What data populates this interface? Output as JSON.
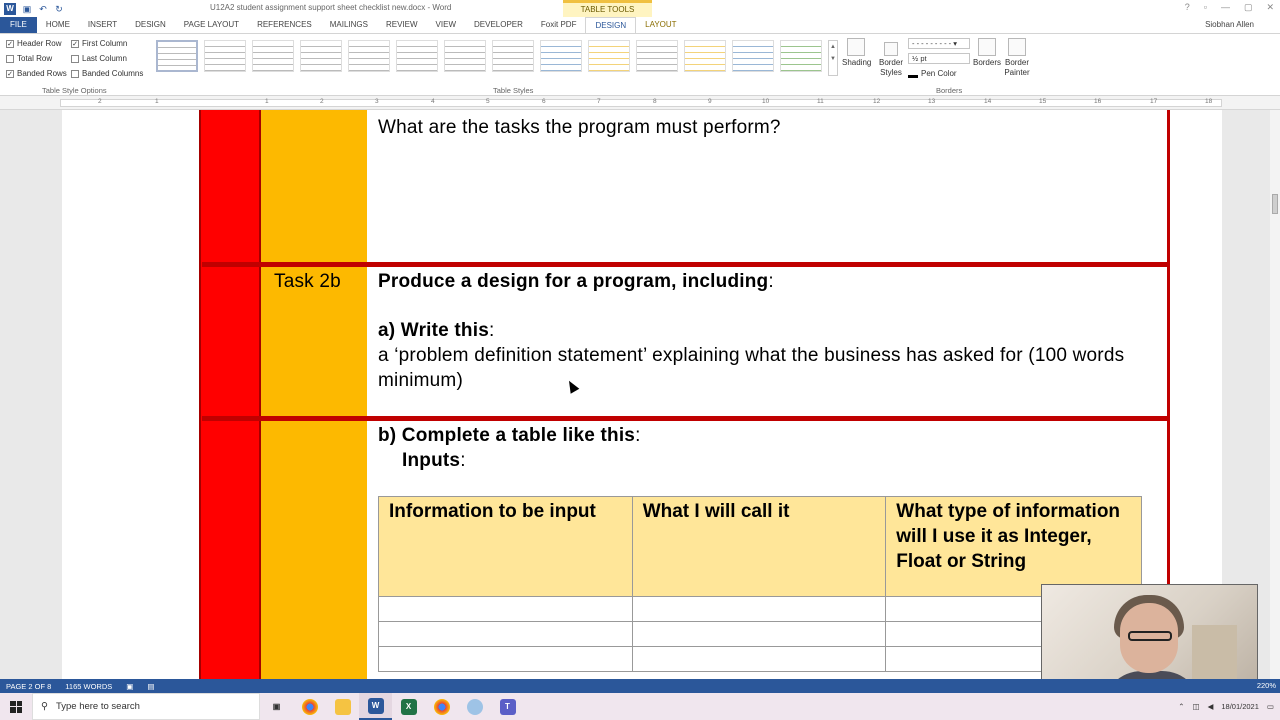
{
  "window": {
    "title": "U12A2 student assignment support sheet checklist new.docx - Word",
    "context_label": "TABLE TOOLS",
    "user": "Siobhan Allen",
    "controls": [
      "?",
      "▫",
      "—",
      "▢",
      "✕"
    ]
  },
  "ribbon_tabs": [
    {
      "label": "FILE"
    },
    {
      "label": "HOME"
    },
    {
      "label": "INSERT"
    },
    {
      "label": "DESIGN"
    },
    {
      "label": "PAGE LAYOUT"
    },
    {
      "label": "REFERENCES"
    },
    {
      "label": "MAILINGS"
    },
    {
      "label": "REVIEW"
    },
    {
      "label": "VIEW"
    },
    {
      "label": "DEVELOPER"
    },
    {
      "label": "Foxit PDF"
    },
    {
      "label": "DESIGN"
    },
    {
      "label": "LAYOUT"
    }
  ],
  "table_style_options": {
    "header_row": "Header Row",
    "total_row": "Total Row",
    "banded_rows": "Banded Rows",
    "first_column": "First Column",
    "last_column": "Last Column",
    "banded_columns": "Banded Columns",
    "group_label": "Table Style Options"
  },
  "table_styles_label": "Table Styles",
  "borders_group": {
    "shading": "Shading",
    "border_styles": "Border Styles",
    "pen_weight": "½ pt",
    "pen_color": "Pen Color",
    "borders": "Borders",
    "border_painter": "Border Painter",
    "group_label": "Borders"
  },
  "ruler_numbers": [
    "2",
    "1",
    "1",
    "2",
    "3",
    "4",
    "5",
    "6",
    "7",
    "8",
    "9",
    "10",
    "11",
    "12",
    "13",
    "14",
    "15",
    "16",
    "17",
    "18"
  ],
  "document": {
    "q1": "What are the tasks the program must perform?",
    "task_label": "Task 2b",
    "produce": "Produce a design for a program, including",
    "produce_colon": ":",
    "write_this": "a) Write this",
    "write_colon": ":",
    "problem_def": "a ‘problem definition statement’ explaining what the business has asked for (100 words minimum)",
    "complete_table": "b) Complete a table like this",
    "complete_colon": ":",
    "inputs": "Inputs",
    "inputs_colon": ":",
    "table_headers": [
      "Information to be input",
      "What I will call it",
      "What type of information will I use it as Integer, Float or String"
    ]
  },
  "status_bar": {
    "page": "PAGE 2 OF 8",
    "words": "1165 WORDS",
    "zoom": "220%"
  },
  "taskbar": {
    "search_placeholder": "Type here to search",
    "date": "18/01/2021"
  }
}
